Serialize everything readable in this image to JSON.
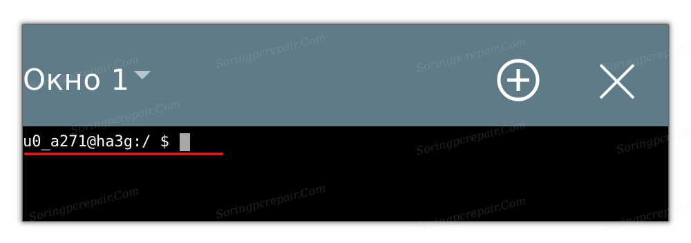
{
  "window": {
    "title": "Окно 1"
  },
  "toolbar": {
    "dropdown_icon": "triangle-down-icon",
    "add_icon": "circle-plus-icon",
    "close_icon": "close-x-icon"
  },
  "terminal": {
    "prompt": "u0_a271@ha3g:/ $ ",
    "highlight_color": "#e0181c"
  },
  "colors": {
    "title_bar": "#5f7b87",
    "terminal_bg": "#000000",
    "text": "#ffffff",
    "cursor": "#a8a8a8"
  },
  "watermark": {
    "text": "Soringpcrepair.Com"
  }
}
